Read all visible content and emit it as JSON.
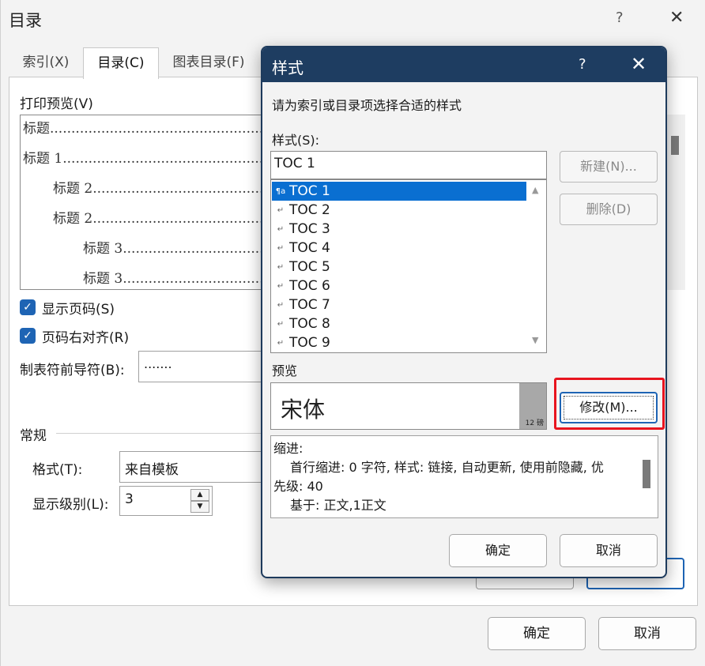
{
  "toc_dialog": {
    "title": "目录",
    "help_icon": "?",
    "close_icon": "✕",
    "tabs": [
      {
        "label": "索引(X)"
      },
      {
        "label": "目录(C)"
      },
      {
        "label": "图表目录(F)"
      }
    ],
    "print_preview_label": "打印预览(V)",
    "preview_lines": [
      "标题",
      "标题 1",
      "标题 2",
      "标题 2",
      "标题 3",
      "标题 3"
    ],
    "show_page_numbers": {
      "label": "显示页码(S)",
      "checked": true
    },
    "right_align": {
      "label": "页码右对齐(R)",
      "checked": true
    },
    "tab_leader": {
      "label": "制表符前导符(B):",
      "value": "......."
    },
    "general_section": "常规",
    "format": {
      "label": "格式(T):",
      "value": "来自模板"
    },
    "levels": {
      "label": "显示级别(L):",
      "value": "3"
    },
    "ok": "确定",
    "cancel": "取消"
  },
  "style_dialog": {
    "title": "样式",
    "help_icon": "?",
    "close_icon": "✕",
    "instruction": "请为索引或目录项选择合适的样式",
    "style_label": "样式(S):",
    "style_value": "TOC 1",
    "styles": [
      "TOC 1",
      "TOC 2",
      "TOC 3",
      "TOC 4",
      "TOC 5",
      "TOC 6",
      "TOC 7",
      "TOC 8",
      "TOC 9"
    ],
    "selected_style": "TOC 1",
    "new_button": "新建(N)...",
    "delete_button": "删除(D)",
    "preview_label": "预览",
    "preview_font": "宋体",
    "preview_size": "12 磅",
    "modify_button": "修改(M)...",
    "description": {
      "line1": "缩进:",
      "line2": "首行缩进:  0 字符, 样式: 链接, 自动更新, 使用前隐藏, 优",
      "line3": "先级: 40",
      "line4": "基于: 正文,1正文"
    },
    "ok": "确定",
    "cancel": "取消",
    "highlight_color": "#e8141e",
    "accent_color": "#0a6fd1"
  }
}
